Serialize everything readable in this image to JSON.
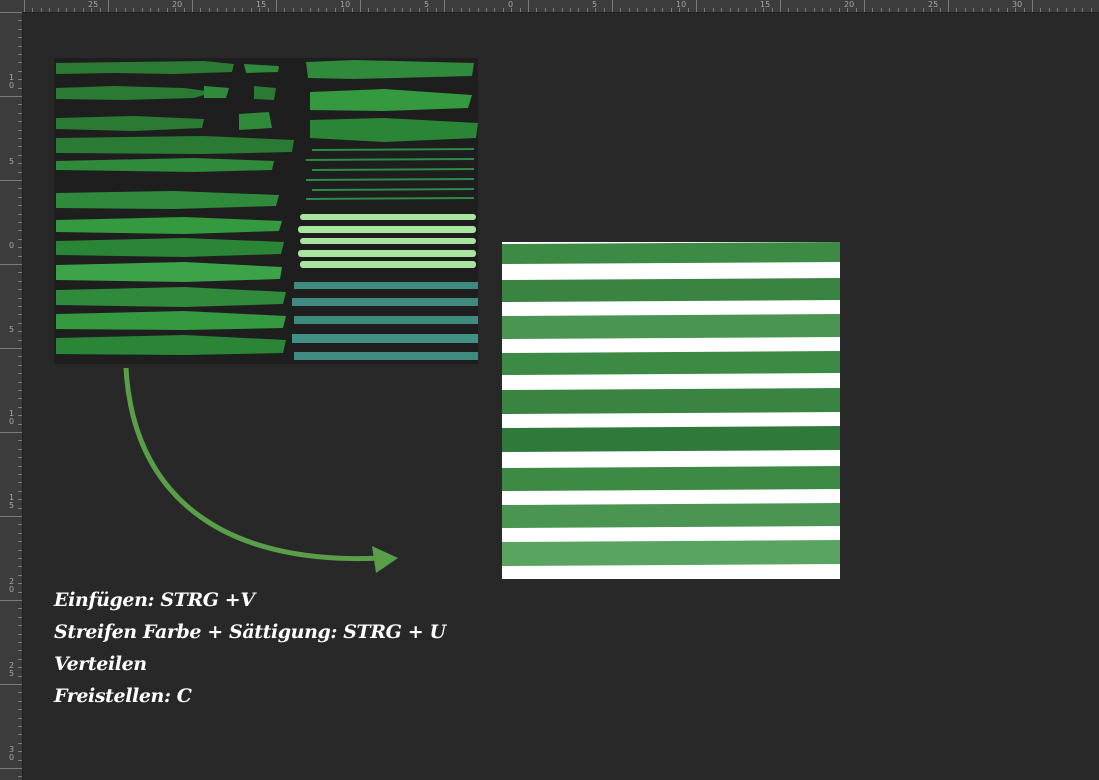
{
  "ruler": {
    "top_labels": [
      "25",
      "20",
      "15",
      "10",
      "5",
      "0",
      "5",
      "10",
      "15",
      "20",
      "25",
      "30"
    ],
    "left_labels": [
      "10",
      "5",
      "0",
      "5",
      "10",
      "15",
      "20",
      "25",
      "30"
    ]
  },
  "colors": {
    "background": "#282828",
    "ruler": "#3c3c3c",
    "stroke_green": "#2f8a3c",
    "stroke_light_green": "#a8e6a0",
    "stroke_teal": "#4fb8a8",
    "arrow": "#5a9e4a",
    "pattern_green": "#3d8a45",
    "text": "#ffffff"
  },
  "icons": {
    "arrow": "curved-arrow-icon"
  },
  "instructions": {
    "line1": "Einfügen: STRG +V",
    "line2": "Streifen Farbe + Sättigung: STRG + U",
    "line3": "Verteilen",
    "line4": "Freistellen: C"
  }
}
